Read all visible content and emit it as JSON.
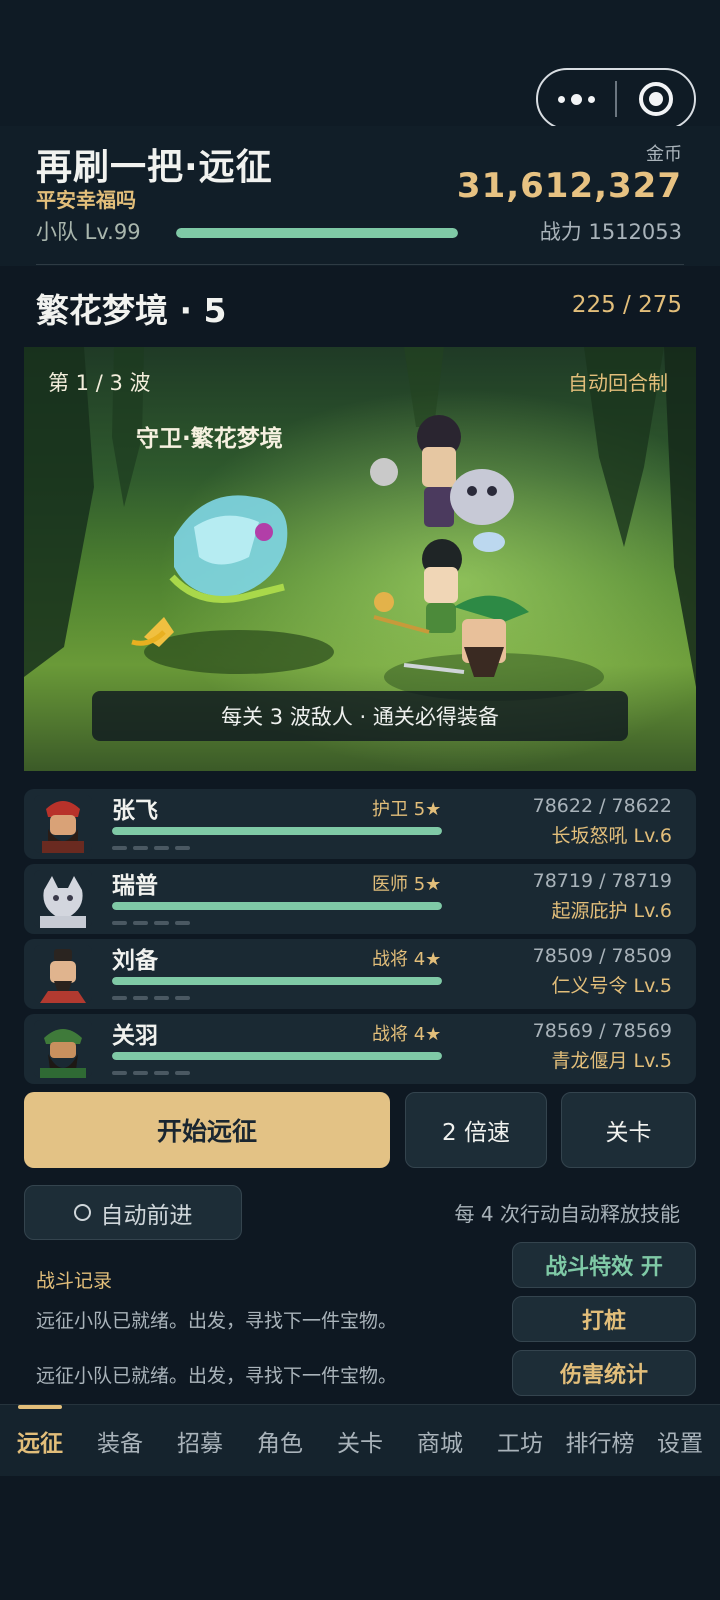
{
  "header": {
    "title": "再刷一把·远征",
    "subtitle": "平安幸福吗",
    "coin_label": "金币",
    "coin_value": "31,612,327",
    "team_level": "小队 Lv.99",
    "team_progress": 1.0,
    "power": "战力 1512053"
  },
  "stage": {
    "name": "繁花梦境 · 5",
    "progress": "225 / 275"
  },
  "battle": {
    "wave": "第 1 / 3 波",
    "mode": "自动回合制",
    "enemy_name": "守卫·繁花梦境",
    "banner": "每关 3 波敌人 · 通关必得装备"
  },
  "heroes": [
    {
      "name": "张飞",
      "role": "护卫 5★",
      "hp": "78622 / 78622",
      "skill": "长坂怒吼 Lv.6",
      "hp_fraction": 1.0
    },
    {
      "name": "瑞普",
      "role": "医师 5★",
      "hp": "78719 / 78719",
      "skill": "起源庇护 Lv.6",
      "hp_fraction": 1.0
    },
    {
      "name": "刘备",
      "role": "战将 4★",
      "hp": "78509 / 78509",
      "skill": "仁义号令 Lv.5",
      "hp_fraction": 1.0
    },
    {
      "name": "关羽",
      "role": "战将 4★",
      "hp": "78569 / 78569",
      "skill": "青龙偃月 Lv.5",
      "hp_fraction": 1.0
    }
  ],
  "controls": {
    "start": "开始远征",
    "speed": "2 倍速",
    "stage": "关卡",
    "auto_advance": "自动前进",
    "auto_hint": "每 4 次行动自动释放技能"
  },
  "log": {
    "title": "战斗记录",
    "lines": [
      "远征小队已就绪。出发，寻找下一件宝物。",
      "远征小队已就绪。出发，寻找下一件宝物。"
    ]
  },
  "side_buttons": {
    "effects": "战斗特效 开",
    "dummy": "打桩",
    "damage": "伤害统计"
  },
  "tabs": [
    "远征",
    "装备",
    "招募",
    "角色",
    "关卡",
    "商城",
    "工坊",
    "排行榜",
    "设置"
  ],
  "colors": {
    "accent": "#e2be7a",
    "hp_bar": "#7fc9a6",
    "background": "#0e1822"
  }
}
